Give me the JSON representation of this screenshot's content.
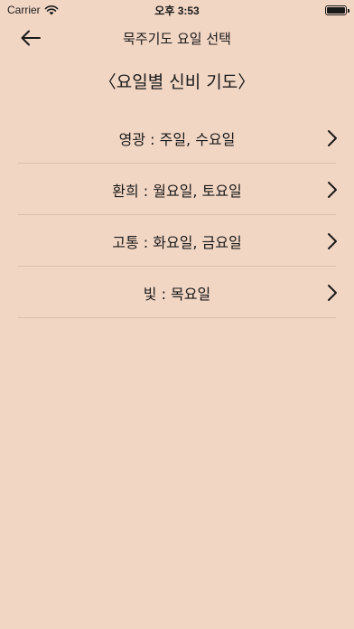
{
  "status_bar": {
    "carrier": "Carrier",
    "time": "오후 3:53"
  },
  "nav": {
    "title": "묵주기도 요일 선택"
  },
  "section": {
    "title": "〈요일별 신비 기도〉"
  },
  "items": [
    {
      "label": "영광 : 주일, 수요일"
    },
    {
      "label": "환희 : 월요일, 토요일"
    },
    {
      "label": "고통 : 화요일, 금요일"
    },
    {
      "label": "빛 : 목요일"
    }
  ],
  "colors": {
    "background": "#f2d6c4",
    "divider": "#dcc0ae",
    "text": "#1a1a1a"
  }
}
